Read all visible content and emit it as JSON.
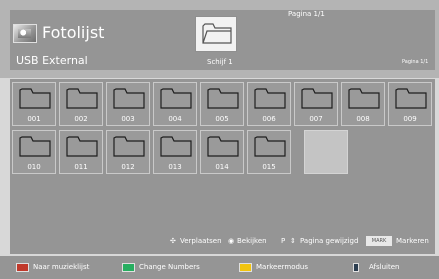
{
  "header": {
    "app_title": "Fotolijst",
    "source_label": "USB External",
    "drive_label": "Schijf 1",
    "page_top": "Pagina 1/1",
    "page_right": "Pagina 1/1"
  },
  "folders": [
    {
      "label": "001"
    },
    {
      "label": "002"
    },
    {
      "label": "003"
    },
    {
      "label": "004"
    },
    {
      "label": "005"
    },
    {
      "label": "006"
    },
    {
      "label": "007"
    },
    {
      "label": "008"
    },
    {
      "label": "009"
    },
    {
      "label": "010"
    },
    {
      "label": "011"
    },
    {
      "label": "012"
    },
    {
      "label": "013"
    },
    {
      "label": "014"
    },
    {
      "label": "015"
    }
  ],
  "legend": {
    "move": "Verplaatsen",
    "view": "Bekijken",
    "page_key": "P",
    "page_change": "Pagina gewijzigd",
    "mark_key": "MARK",
    "mark": "Markeren"
  },
  "bottom_bar": {
    "items": [
      {
        "label": "Naar muzieklijst",
        "color": "#c0392b"
      },
      {
        "label": "Change Numbers",
        "color": "#27ae60"
      },
      {
        "label": "Markeermodus",
        "color": "#f1c40f"
      },
      {
        "label": "Afsluiten",
        "color": "#2c3e50"
      }
    ]
  },
  "colors": {
    "panel": "#959595",
    "header_bg": "#b4b4b4",
    "text": "#ffffff"
  }
}
